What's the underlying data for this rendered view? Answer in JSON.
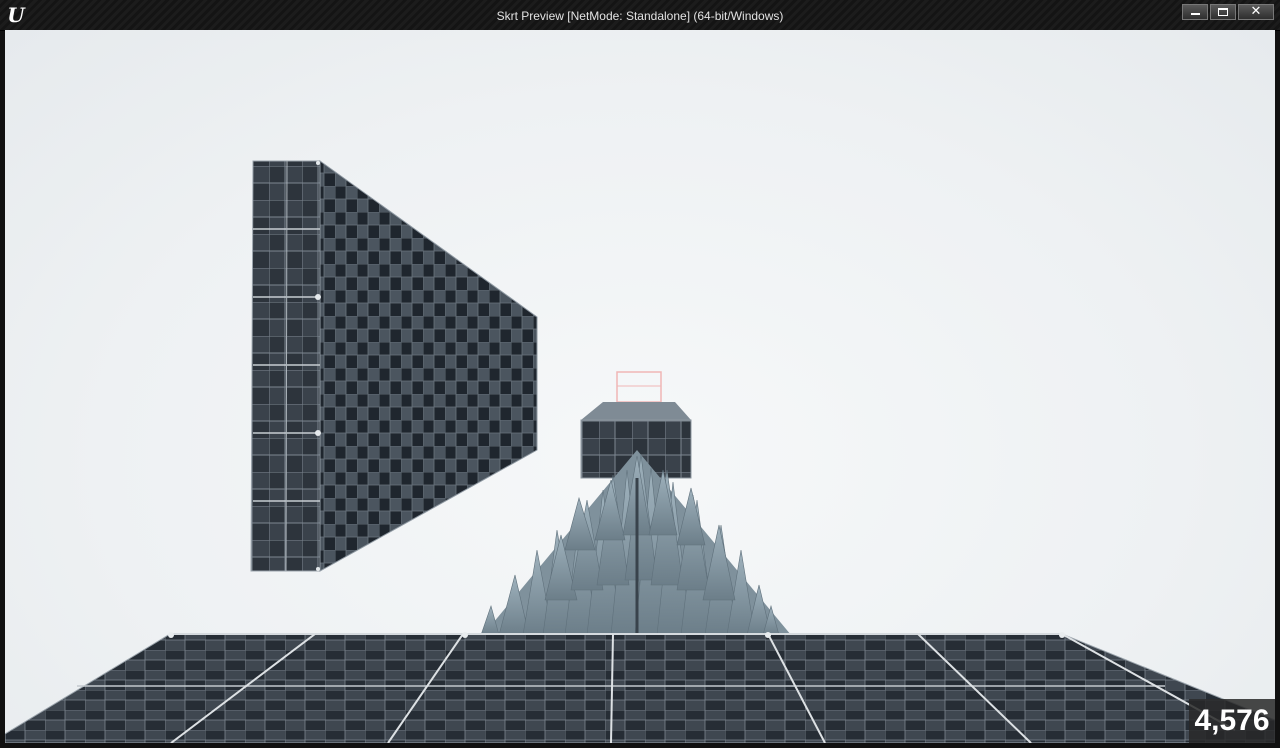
{
  "window": {
    "title": "Skrt Preview [NetMode: Standalone] (64-bit/Windows)",
    "logo": "U",
    "buttons": {
      "minimize": "minimize-icon",
      "maximize": "maximize-icon",
      "close": "✕"
    }
  },
  "viewport": {
    "counter": "4,576",
    "sky_color": "#eef1f3",
    "tile_dark": "#2b323b",
    "tile_light": "#59626b",
    "spike_color": "#8fa3af"
  }
}
